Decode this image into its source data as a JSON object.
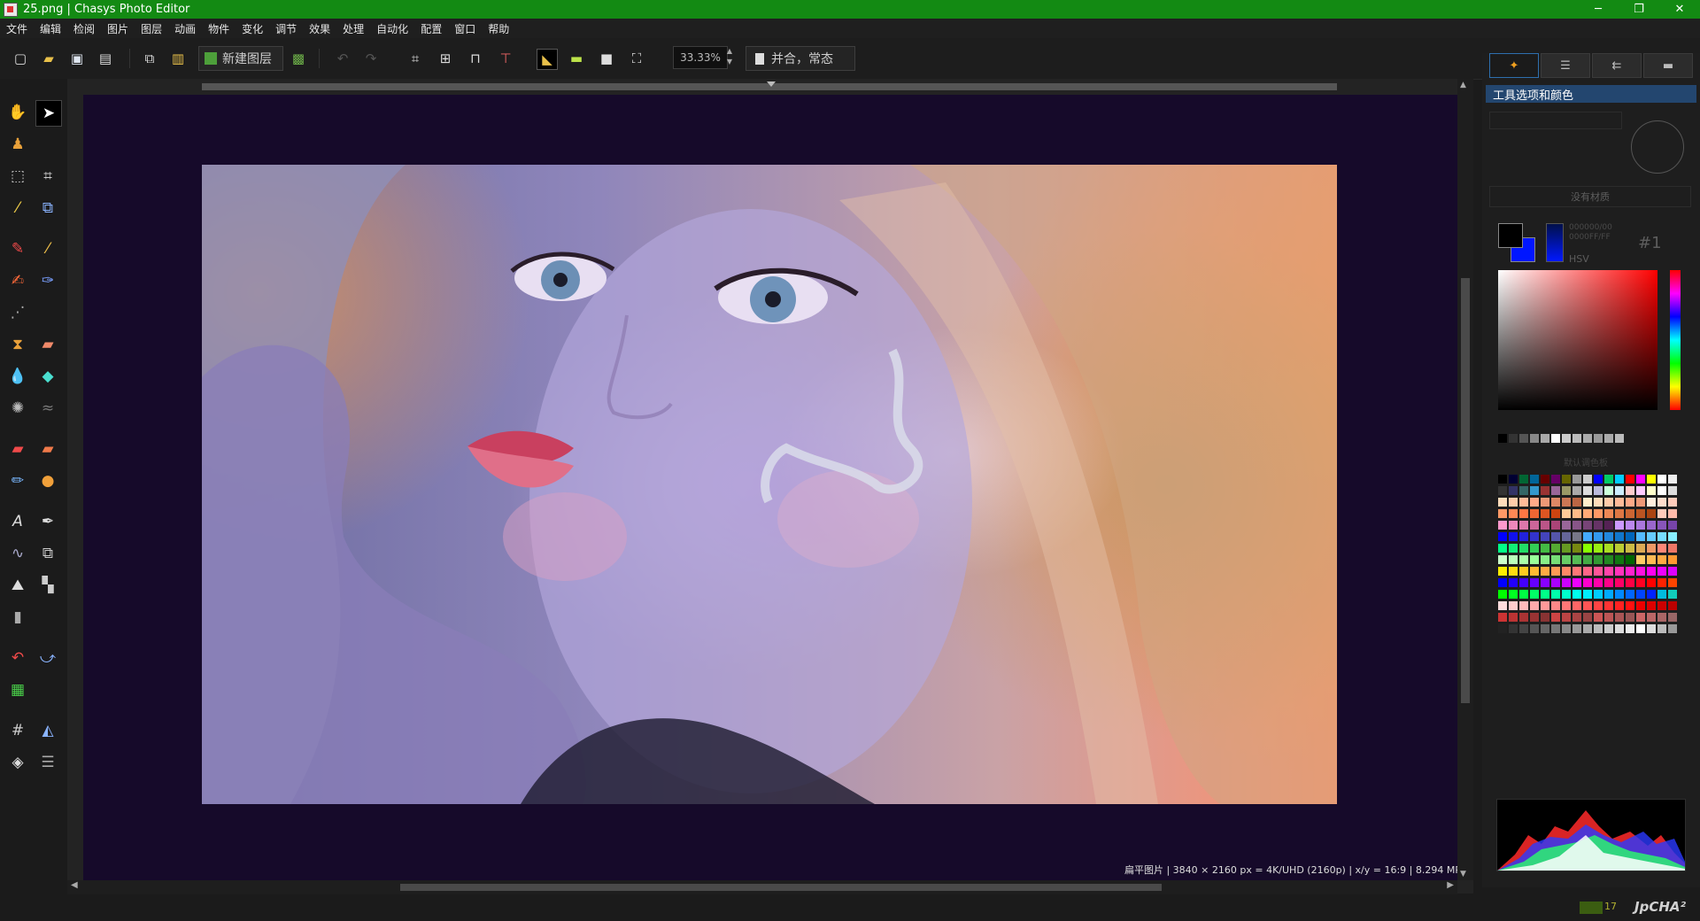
{
  "window": {
    "title": "25.png | Chasys Photo Editor",
    "minimize": "─",
    "restore": "❐",
    "close": "✕"
  },
  "menu": [
    "文件",
    "编辑",
    "检阅",
    "图片",
    "图层",
    "动画",
    "物件",
    "变化",
    "调节",
    "效果",
    "处理",
    "自动化",
    "配置",
    "窗口",
    "帮助"
  ],
  "toolbar": {
    "new_layer_label": "新建图层",
    "zoom_value": "33.33%",
    "merge_label": "并合，常态"
  },
  "canvas": {
    "status_text": "扁平图片 | 3840 × 2160 px = 4K/UHD (2160p) | x/y = 16:9 | 8.294 MP"
  },
  "right_panel": {
    "tabs": [
      "tools",
      "layers",
      "history",
      "files"
    ],
    "panel_title": "工具选项和颜色",
    "no_texture": "没有材质",
    "hex_line1": "000000/00",
    "hex_line2": "0000FF/FF",
    "slot_label": "#1",
    "mode_label": "HSV",
    "palette_title": "默认调色板",
    "fg_color": "#000000",
    "bg_color": "#0016ff"
  },
  "footer": {
    "jpcha": "JpCHA²",
    "counter": "17"
  },
  "icons": [
    "hand-icon",
    "pointer-icon",
    "stamp-icon",
    "select-rect-icon",
    "crop-icon",
    "magic-wand-icon",
    "transform-icon",
    "pencil-icon",
    "eyedropper-icon",
    "brush-icon",
    "airbrush-icon",
    "pixel-icon",
    "clone-icon",
    "eraser-icon",
    "blur-icon",
    "sharpen-icon",
    "burst-icon",
    "smudge-icon",
    "fill-icon",
    "gradient-icon",
    "text-icon",
    "pen-icon",
    "curve-icon",
    "shape-icon",
    "mountain-icon",
    "layer-icon",
    "box-icon",
    "undo-icon",
    "redo-icon",
    "rgb-icon",
    "grid-icon",
    "measure-icon",
    "diamond-icon",
    "lines-icon"
  ]
}
